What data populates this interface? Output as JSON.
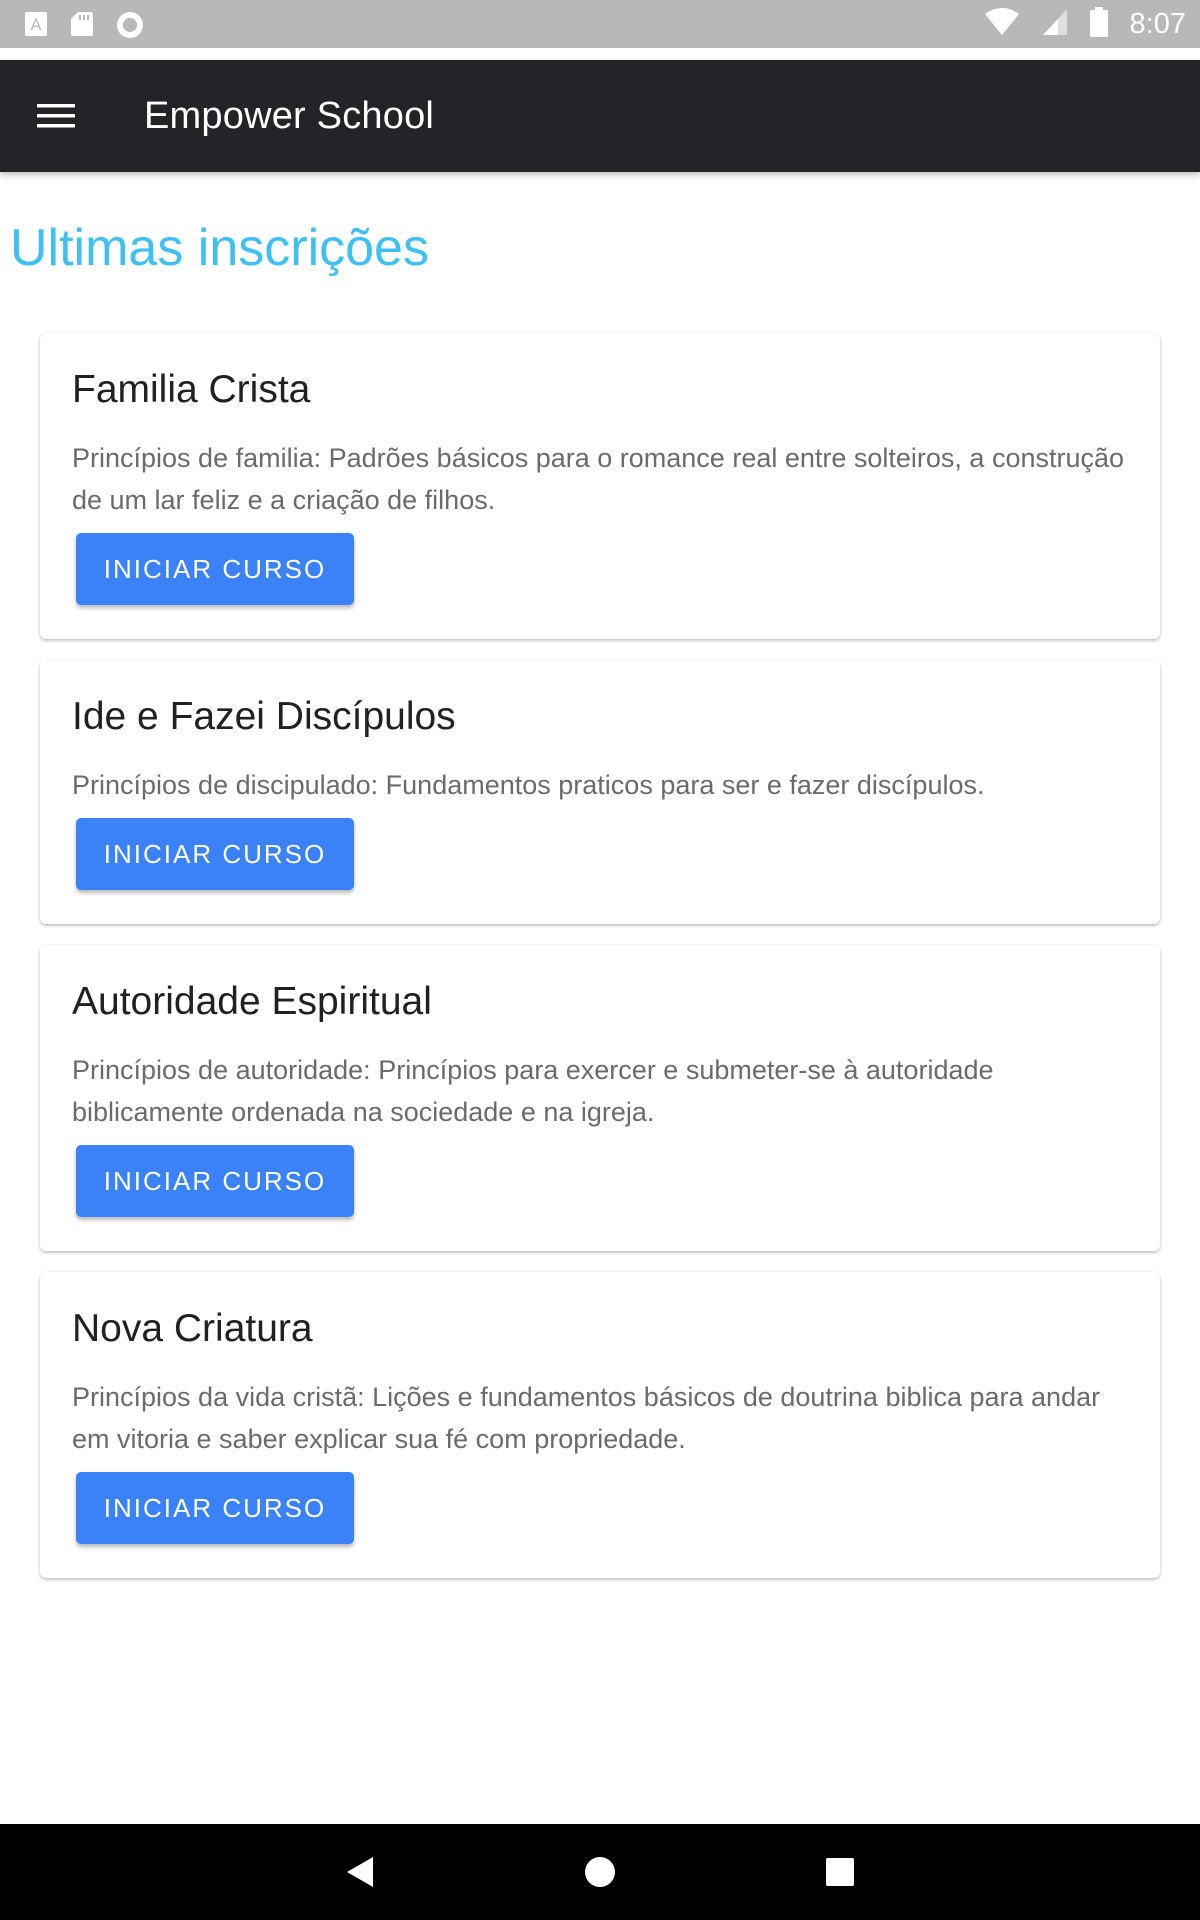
{
  "status_bar": {
    "time": "8:07",
    "left_icons": [
      "text-a-notification-icon",
      "sd-card-icon",
      "circle-notification-icon"
    ],
    "right_icons": [
      "wifi-icon",
      "cell-signal-icon",
      "battery-icon"
    ]
  },
  "app_bar": {
    "menu_icon": "hamburger-menu-icon",
    "title": "Empower School"
  },
  "section": {
    "title": "Ultimas inscrições"
  },
  "courses": [
    {
      "title": "Familia Crista",
      "description": "Princípios de familia: Padrões básicos para o romance real entre solteiros, a construção de um lar feliz e a criação de filhos.",
      "button_label": "INICIAR CURSO"
    },
    {
      "title": "Ide e Fazei Discípulos",
      "description": "Princípios de discipulado: Fundamentos praticos para ser e fazer discípulos.",
      "button_label": "INICIAR CURSO"
    },
    {
      "title": "Autoridade Espiritual",
      "description": "Princípios de autoridade: Princípios para exercer e submeter-se à autoridade biblicamente ordenada na sociedade e na igreja.",
      "button_label": "INICIAR CURSO"
    },
    {
      "title": "Nova Criatura",
      "description": "Princípios da vida cristã: Lições e fundamentos básicos de doutrina biblica para andar em vitoria e saber explicar sua fé com propriedade.",
      "button_label": "INICIAR CURSO"
    }
  ],
  "nav_bar": {
    "icons": [
      "back-icon",
      "home-icon",
      "recents-icon"
    ]
  },
  "colors": {
    "app_bar": "#222428",
    "accent_title": "#3ec0f3",
    "button": "#3b82f8",
    "status_bar": "#b8b8b8"
  }
}
